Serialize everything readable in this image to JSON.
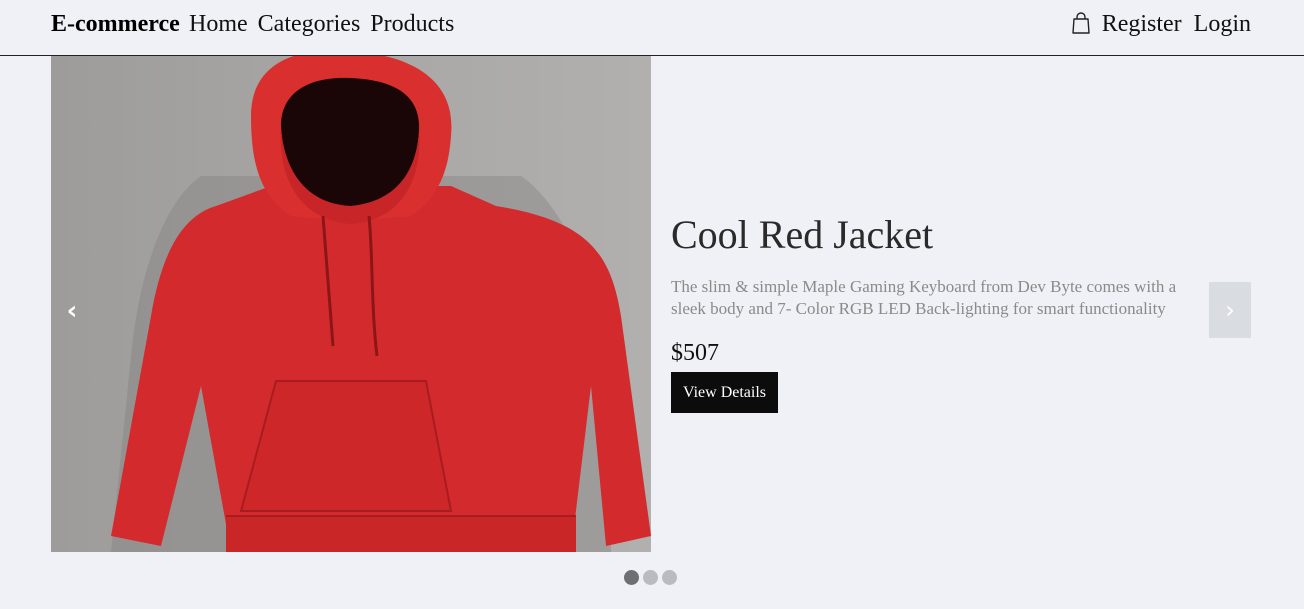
{
  "navbar": {
    "brand": "E-commerce",
    "links": [
      "Home",
      "Categories",
      "Products"
    ],
    "register": "Register",
    "login": "Login",
    "cart_icon": "shopping-bag-icon"
  },
  "carousel": {
    "prev_symbol": "‹",
    "next_symbol": "›",
    "slide": {
      "image_subject": "red hoodie",
      "title": "Cool Red Jacket",
      "description": "The slim & simple Maple Gaming Keyboard from Dev Byte comes with a sleek body and 7- Color RGB LED Back-lighting for smart functionality",
      "price": "$507",
      "button": "View Details"
    },
    "indicators": {
      "count": 3,
      "active": 0
    }
  },
  "colors": {
    "background": "#eff1f6",
    "button": "#0c0c0c",
    "hoodie": "#d32b2d"
  }
}
